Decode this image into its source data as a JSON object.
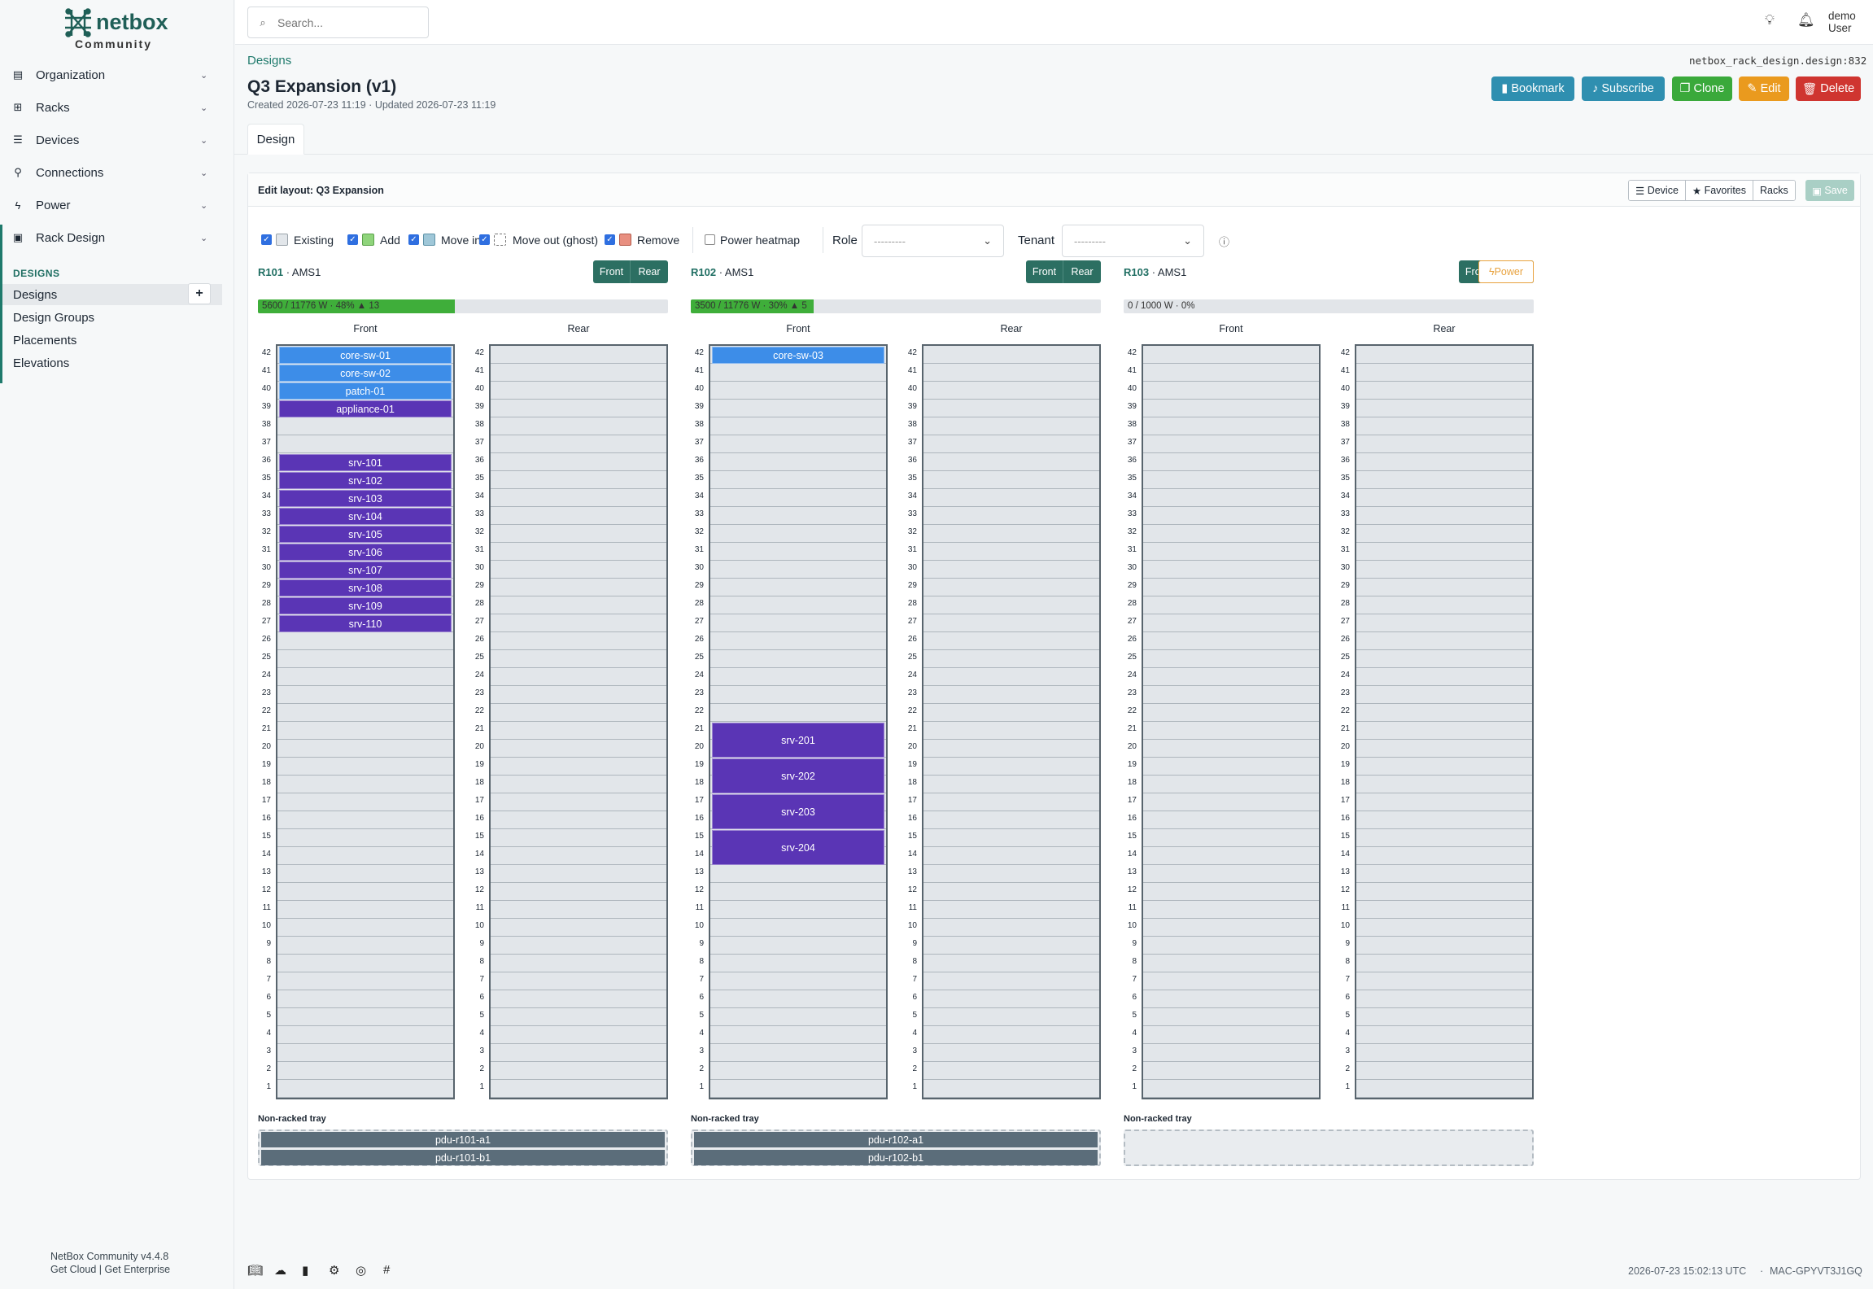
{
  "brand": {
    "name": "netbox",
    "sub": "Community"
  },
  "sidebar": {
    "items": [
      {
        "label": "Organization",
        "icon": "building-icon"
      },
      {
        "label": "Racks",
        "icon": "rack-icon"
      },
      {
        "label": "Devices",
        "icon": "server-icon"
      },
      {
        "label": "Connections",
        "icon": "cable-icon"
      },
      {
        "label": "Power",
        "icon": "bolt-icon"
      },
      {
        "label": "Rack Design",
        "icon": "layout-icon"
      }
    ],
    "section": "DESIGNS",
    "sub": [
      "Designs",
      "Design Groups",
      "Placements",
      "Elevations"
    ],
    "footer_version": "NetBox Community v4.4.8",
    "footer_links": "Get Cloud | Get Enterprise"
  },
  "topbar": {
    "search_placeholder": "Search...",
    "user_name": "demo",
    "user_role": "User"
  },
  "page": {
    "breadcrumb": "Designs",
    "object_id": "netbox_rack_design.design:832",
    "title": "Q3 Expansion (v1)",
    "meta": "Created 2026-07-23 11:19 · Updated 2026-07-23 11:19",
    "actions": {
      "bookmark": "Bookmark",
      "subscribe": "Subscribe",
      "clone": "Clone",
      "edit": "Edit",
      "delete": "Delete"
    },
    "tab": "Design"
  },
  "editor": {
    "title": "Edit layout: Q3 Expansion",
    "buttons": {
      "device": "Device",
      "favorites": "Favorites",
      "racks": "Racks",
      "save": "Save"
    },
    "legend": {
      "existing": "Existing",
      "add": "Add",
      "move_in": "Move in",
      "move_out": "Move out (ghost)",
      "remove": "Remove",
      "heatmap": "Power heatmap"
    },
    "role_label": "Role",
    "role_value": "---------",
    "tenant_label": "Tenant",
    "tenant_value": "---------",
    "colors": {
      "existing": "#e2e6ea",
      "add": "#8fd47b",
      "move_in": "#9fc7d8",
      "remove": "#e88f80",
      "device_blue": "#3d8de8",
      "device_purple": "#5a35b5",
      "tray_device": "#5b6d7a",
      "accent": "#1f7a6c"
    }
  },
  "racks": [
    {
      "name": "R101",
      "site": "AMS1",
      "front": "Front",
      "rear": "Rear",
      "power_text": "5600 / 11776 W · 48% ▲ 13",
      "power_pct": 48,
      "face_front": "Front",
      "face_rear": "Rear",
      "devices": [
        {
          "name": "core-sw-01",
          "u": 42,
          "h": 1,
          "color": "blue"
        },
        {
          "name": "core-sw-02",
          "u": 41,
          "h": 1,
          "color": "blue"
        },
        {
          "name": "patch-01",
          "u": 40,
          "h": 1,
          "color": "blue"
        },
        {
          "name": "appliance-01",
          "u": 39,
          "h": 1,
          "color": "purple"
        },
        {
          "name": "srv-101",
          "u": 36,
          "h": 1,
          "color": "purple"
        },
        {
          "name": "srv-102",
          "u": 35,
          "h": 1,
          "color": "purple"
        },
        {
          "name": "srv-103",
          "u": 34,
          "h": 1,
          "color": "purple"
        },
        {
          "name": "srv-104",
          "u": 33,
          "h": 1,
          "color": "purple"
        },
        {
          "name": "srv-105",
          "u": 32,
          "h": 1,
          "color": "purple"
        },
        {
          "name": "srv-106",
          "u": 31,
          "h": 1,
          "color": "purple"
        },
        {
          "name": "srv-107",
          "u": 30,
          "h": 1,
          "color": "purple"
        },
        {
          "name": "srv-108",
          "u": 29,
          "h": 1,
          "color": "purple"
        },
        {
          "name": "srv-109",
          "u": 28,
          "h": 1,
          "color": "purple"
        },
        {
          "name": "srv-110",
          "u": 27,
          "h": 1,
          "color": "purple"
        }
      ],
      "tray_label": "Non-racked tray",
      "tray": [
        "pdu-r101-a1",
        "pdu-r101-b1"
      ]
    },
    {
      "name": "R102",
      "site": "AMS1",
      "front": "Front",
      "rear": "Rear",
      "power_text": "3500 / 11776 W · 30% ▲ 5",
      "power_pct": 30,
      "face_front": "Front",
      "face_rear": "Rear",
      "devices": [
        {
          "name": "core-sw-03",
          "u": 42,
          "h": 1,
          "color": "blue"
        },
        {
          "name": "srv-201",
          "u": 21,
          "h": 2,
          "color": "purple"
        },
        {
          "name": "srv-202",
          "u": 19,
          "h": 2,
          "color": "purple"
        },
        {
          "name": "srv-203",
          "u": 17,
          "h": 2,
          "color": "purple"
        },
        {
          "name": "srv-204",
          "u": 15,
          "h": 2,
          "color": "purple"
        }
      ],
      "tray_label": "Non-racked tray",
      "tray": [
        "pdu-r102-a1",
        "pdu-r102-b1"
      ]
    },
    {
      "name": "R103",
      "site": "AMS1",
      "front": "Front",
      "rear": "Rear",
      "power_btn": "Power",
      "power_text": "0 / 1000 W · 0%",
      "power_pct": 0,
      "face_front": "Front",
      "face_rear": "Rear",
      "devices": [],
      "tray_label": "Non-racked tray",
      "tray": []
    }
  ],
  "footer": {
    "timestamp": "2026-07-23 15:02:13 UTC",
    "separator": "·",
    "host": "MAC-GPYVT3J1GQ"
  }
}
